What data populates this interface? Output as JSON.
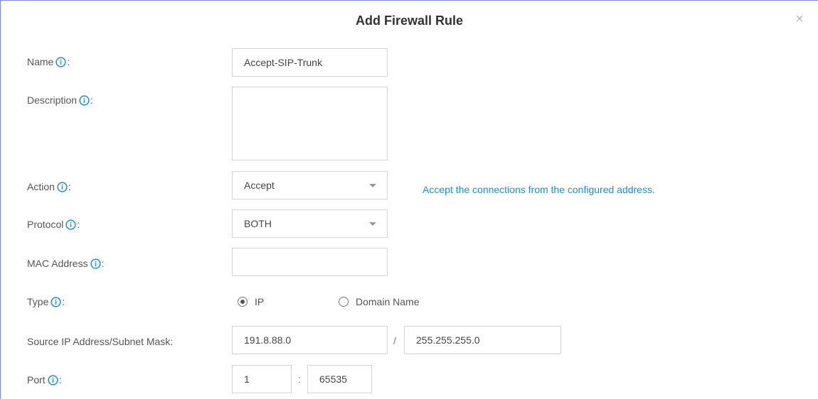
{
  "dialog": {
    "title": "Add Firewall Rule",
    "close_glyph": "×"
  },
  "fields": {
    "name": {
      "label": "Name",
      "value": "Accept-SIP-Trunk"
    },
    "description": {
      "label": "Description",
      "value": ""
    },
    "action": {
      "label": "Action",
      "value": "Accept",
      "hint": "Accept the connections from the configured address."
    },
    "protocol": {
      "label": "Protocol",
      "value": "BOTH"
    },
    "mac": {
      "label": "MAC Address",
      "value": ""
    },
    "type": {
      "label": "Type",
      "options": [
        "IP",
        "Domain Name"
      ],
      "selected": "IP"
    },
    "source": {
      "label": "Source IP Address/Subnet Mask:",
      "ip": "191.8.88.0",
      "separator": "/",
      "mask": "255.255.255.0"
    },
    "port": {
      "label": "Port",
      "from": "1",
      "separator": ":",
      "to": "65535"
    }
  },
  "colors": {
    "accent": "#1a8fd8",
    "info_icon": "#1a8fd8"
  },
  "icons": {
    "info": "info-icon",
    "dropdown": "chevron-down-icon",
    "close": "close-icon"
  }
}
